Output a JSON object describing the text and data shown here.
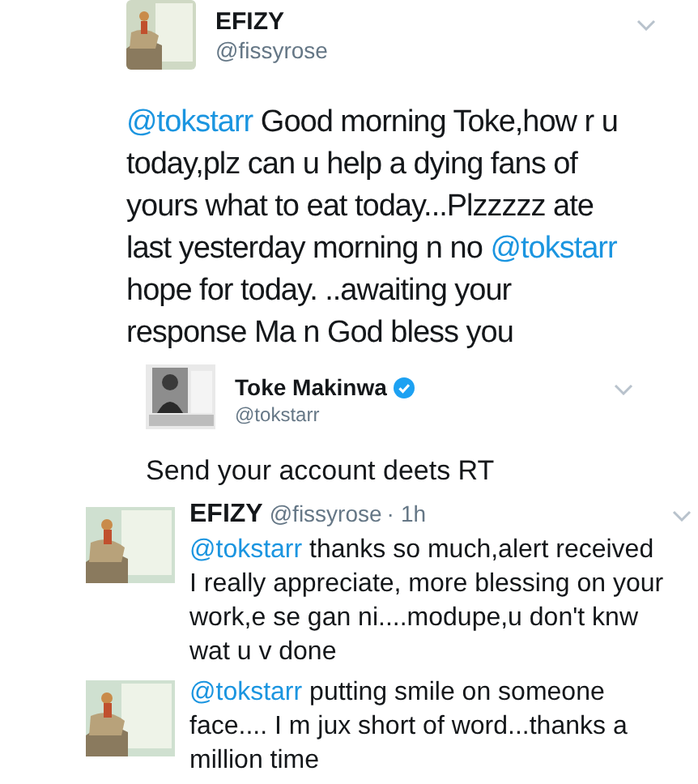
{
  "tweet": {
    "author": {
      "name": "EFIZY",
      "handle": "@fissyrose"
    },
    "body": [
      {
        "kind": "mention",
        "text": "@tokstarr"
      },
      {
        "kind": "text",
        "text": " Good morning Toke,how r u today,plz can u help a dying fans of yours what to eat today...Plzzzzz ate last yesterday morning n no "
      },
      {
        "kind": "mention",
        "text": "@tokstarr"
      },
      {
        "kind": "text",
        "text": " hope for today. ..awaiting your response Ma n God bless you"
      }
    ],
    "quoted": {
      "name": "Toke Makinwa",
      "verified": true,
      "handle": "@tokstarr",
      "body": "Send your account deets RT"
    }
  },
  "replies": [
    {
      "name": "EFIZY",
      "handle": "@fissyrose",
      "separator": "·",
      "time": "1h",
      "body": [
        {
          "kind": "mention",
          "text": "@tokstarr"
        },
        {
          "kind": "text",
          "text": " thanks so much,alert received I really appreciate, more blessing on your work,e se gan ni....modupe,u don't knw wat u v done"
        }
      ]
    },
    {
      "body": [
        {
          "kind": "mention",
          "text": "@tokstarr"
        },
        {
          "kind": "text",
          "text": " putting smile on someone face.... I m jux short of word...thanks a million time"
        }
      ]
    }
  ]
}
